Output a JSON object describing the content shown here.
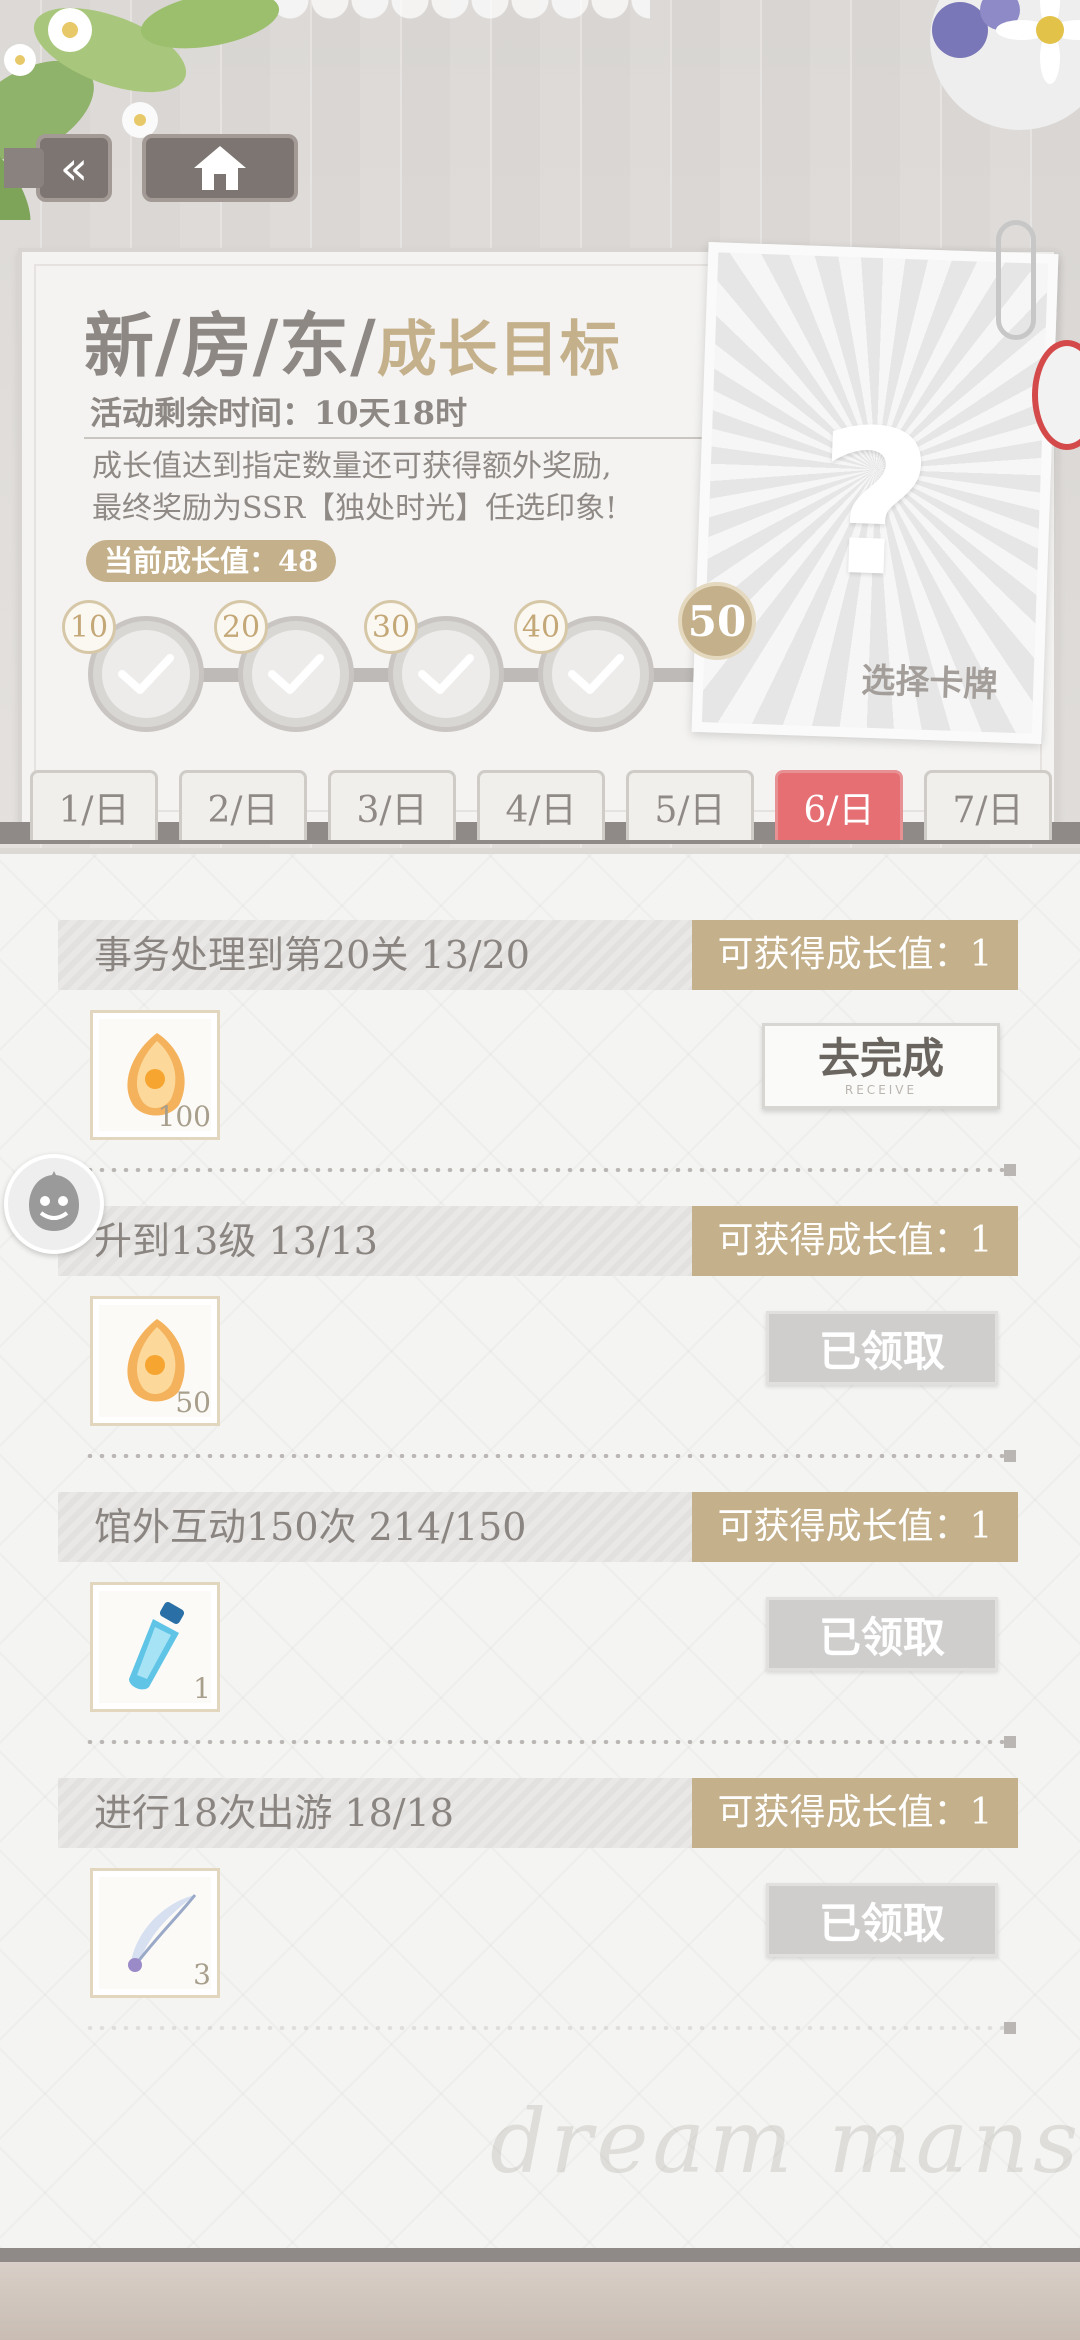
{
  "header": {
    "back_icon": "chevrons-left-icon",
    "home_icon": "home-icon"
  },
  "event": {
    "title_main": "新/房/东/",
    "title_sub": "成长目标",
    "time_label": "活动剩余时间：10天18时",
    "desc_line1": "成长值达到指定数量还可获得额外奖励,",
    "desc_line2": "最终奖励为SSR【独处时光】任选印象!",
    "current_value_label": "当前成长值：48"
  },
  "milestones": {
    "m1": "10",
    "m2": "20",
    "m3": "30",
    "m4": "40",
    "final": "50"
  },
  "reward_card": {
    "symbol": "?",
    "pick_label": "选择卡牌"
  },
  "tabs": {
    "t1": "1/日",
    "t2": "2/日",
    "t3": "3/日",
    "t4": "4/日",
    "t5": "5/日",
    "t6": "6/日",
    "t7": "7/日",
    "active": "6/日"
  },
  "quests": {
    "q1": {
      "title": "事务处理到第20关 13/20",
      "reward": "可获得成长值：1",
      "item_count": "100",
      "button": "去完成",
      "button_sub": "RECEIVE"
    },
    "q2": {
      "title": "升到13级 13/13",
      "reward": "可获得成长值：1",
      "item_count": "50",
      "button": "已领取"
    },
    "q3": {
      "title": "馆外互动150次 214/150",
      "reward": "可获得成长值：1",
      "item_count": "1",
      "button": "已领取"
    },
    "q4": {
      "title": "进行18次出游 18/18",
      "reward": "可获得成长值：1",
      "item_count": "3",
      "button": "已领取"
    }
  },
  "footer": {
    "watermark": "dream mansion"
  },
  "colors": {
    "accent_gold": "#c4b08a",
    "active_tab": "#e56f73",
    "text_gray": "#8a8581"
  }
}
